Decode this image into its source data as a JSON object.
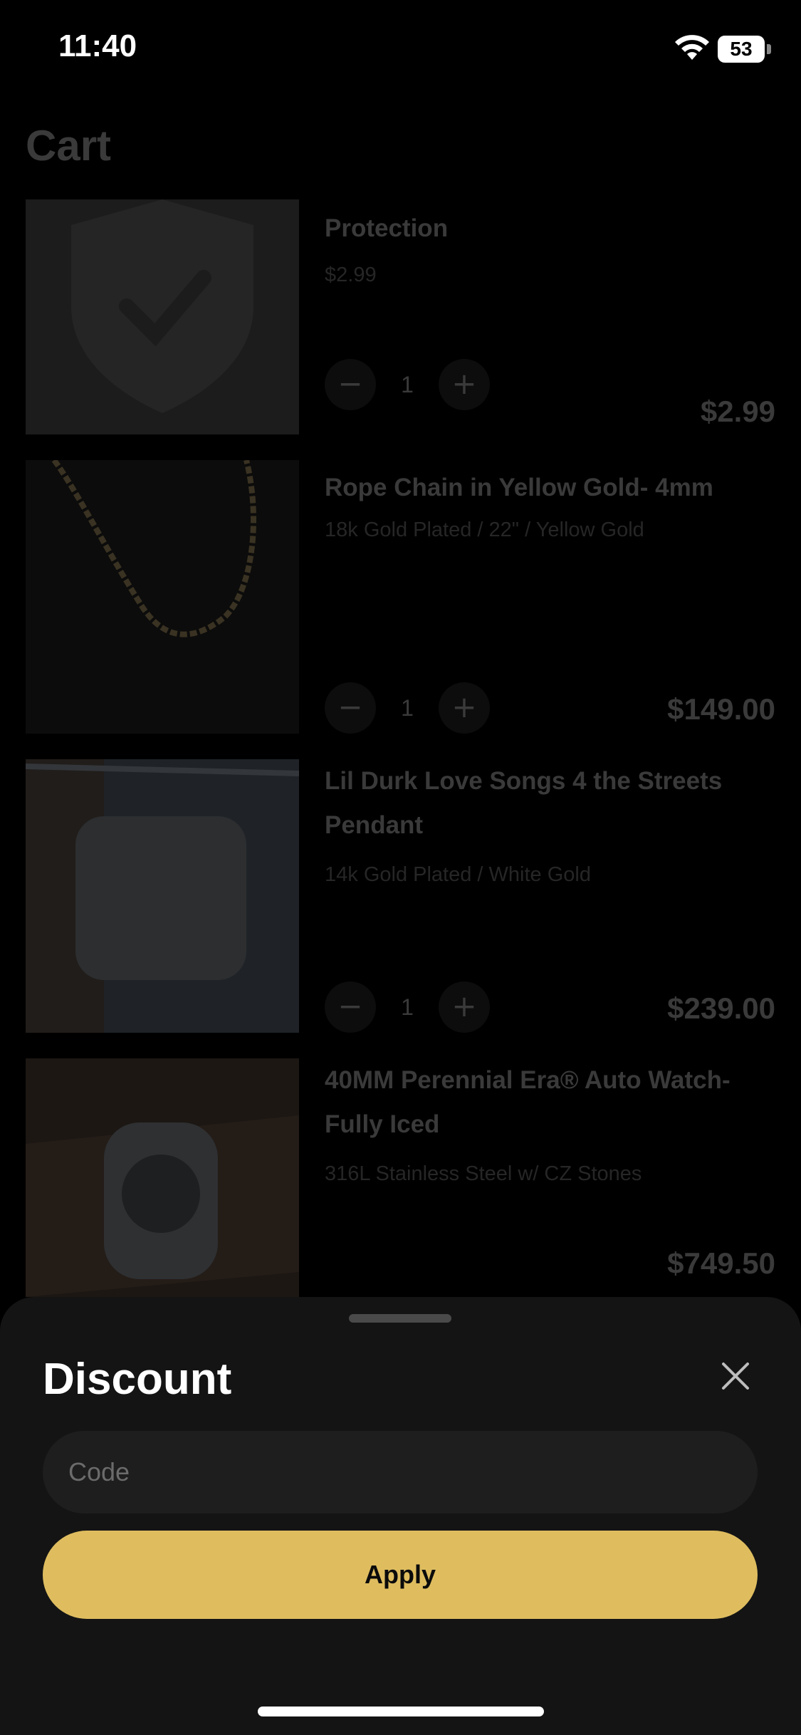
{
  "status_bar": {
    "time": "11:40",
    "battery": "53"
  },
  "cart": {
    "title": "Cart",
    "items": [
      {
        "name": "Protection",
        "variant": "$2.99",
        "quantity": "1",
        "price": "$2.99",
        "image": "shield-check-icon"
      },
      {
        "name": "Rope Chain in Yellow Gold- 4mm",
        "variant": "18k Gold Plated / 22\" / Yellow Gold",
        "quantity": "1",
        "price": "$149.00",
        "image": "rope-chain-photo"
      },
      {
        "name": "Lil Durk Love Songs 4 the Streets Pendant",
        "variant": "14k Gold Plated / White Gold",
        "quantity": "1",
        "price": "$239.00",
        "image": "pendant-photo"
      },
      {
        "name": "40MM Perennial Era® Auto Watch- Fully Iced",
        "variant": "316L Stainless Steel w/ CZ Stones",
        "price": "$749.50",
        "image": "watch-photo"
      }
    ],
    "minus_symbol": "−",
    "plus_symbol": "+"
  },
  "discount_sheet": {
    "title": "Discount",
    "code_placeholder": "Code",
    "apply_label": "Apply"
  },
  "colors": {
    "accent": "#dfbd5f",
    "sheet_bg": "#141414",
    "input_bg": "#1e1e1e"
  }
}
